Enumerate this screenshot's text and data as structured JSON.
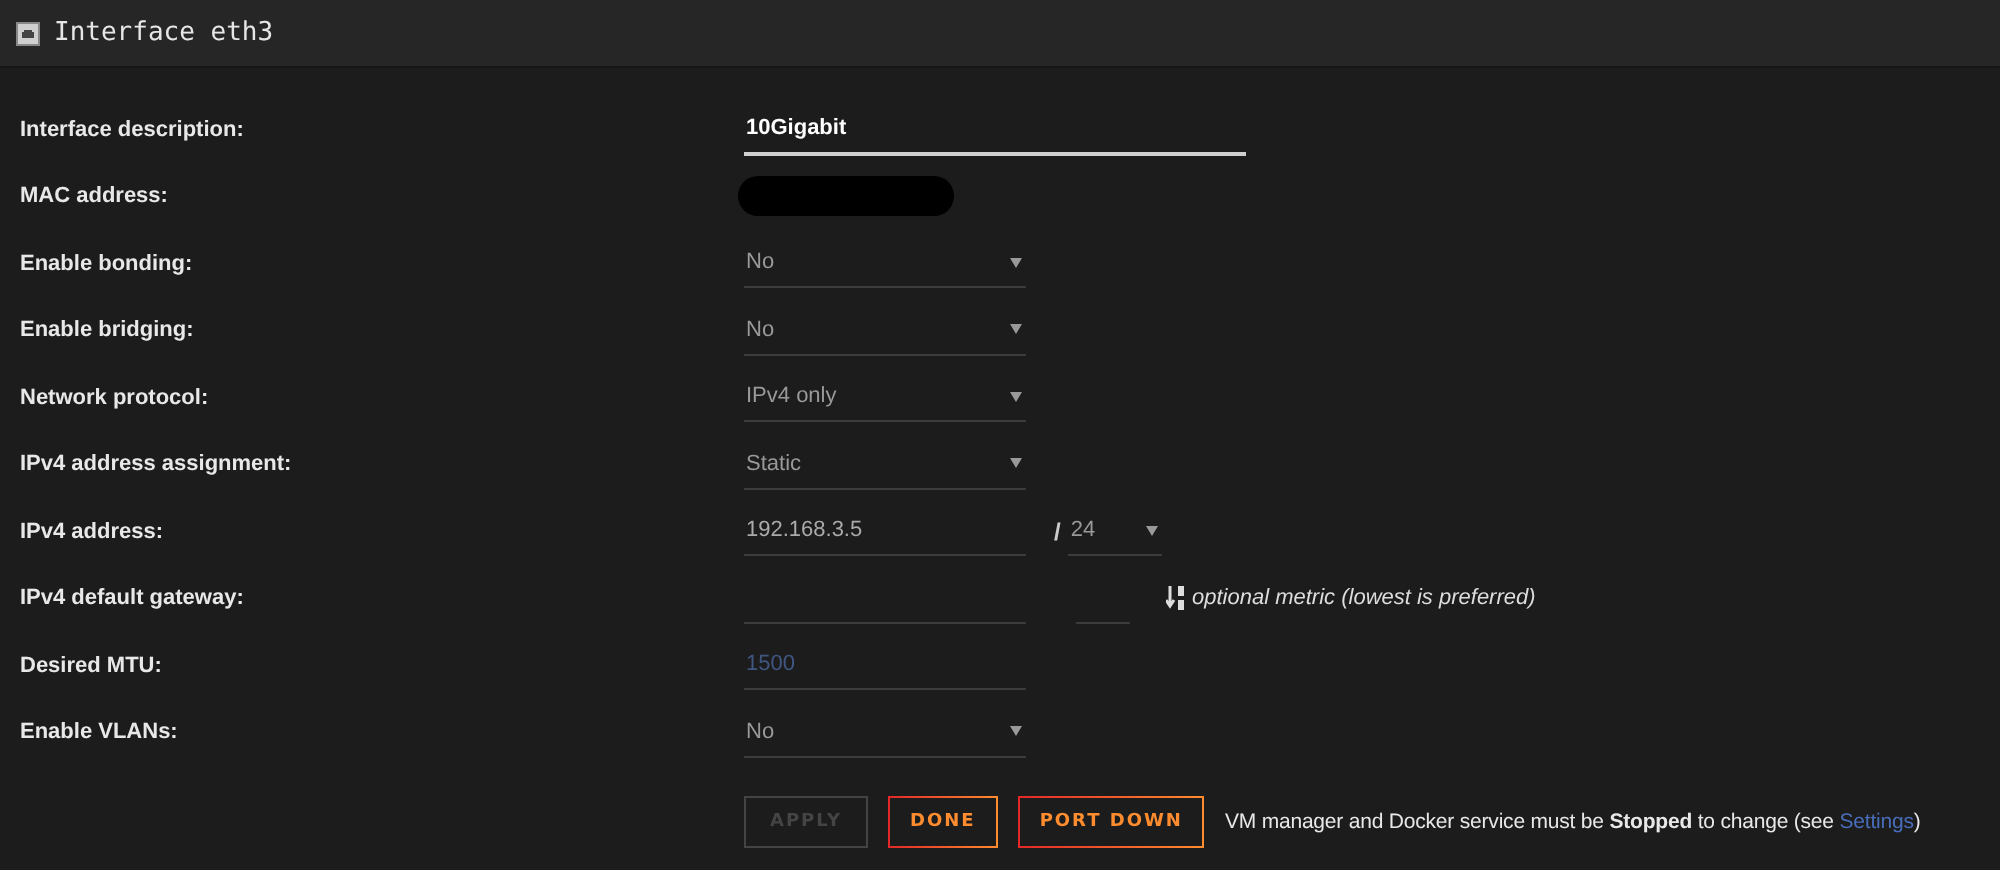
{
  "window": {
    "title": "Interface eth3"
  },
  "rows": [
    {
      "label": "Interface description:",
      "kind": "text",
      "value": "10Gigabit"
    },
    {
      "label": "MAC address:",
      "kind": "redacted"
    },
    {
      "label": "Enable bonding:",
      "kind": "select",
      "value": "No"
    },
    {
      "label": "Enable bridging:",
      "kind": "select",
      "value": "No"
    },
    {
      "label": "Network protocol:",
      "kind": "select",
      "value": "IPv4 only"
    },
    {
      "label": "IPv4 address assignment:",
      "kind": "select",
      "value": "Static"
    },
    {
      "label": "IPv4 address:",
      "kind": "address",
      "value": "192.168.3.5",
      "separator": "/",
      "prefix": "24"
    },
    {
      "label": "IPv4 default gateway:",
      "kind": "gateway",
      "hint": "optional metric (lowest is preferred)"
    },
    {
      "label": "Desired MTU:",
      "kind": "input",
      "placeholder": "1500"
    },
    {
      "label": "Enable VLANs:",
      "kind": "select",
      "value": "No"
    }
  ],
  "buttons": [
    {
      "label": "APPLY",
      "disabled": true
    },
    {
      "label": "DONE",
      "disabled": false
    },
    {
      "label": "PORT DOWN",
      "disabled": false
    }
  ],
  "notice": {
    "text": "VM manager and Docker service must be **Stopped** to change (see",
    "link": "Settings",
    "after": ")"
  }
}
